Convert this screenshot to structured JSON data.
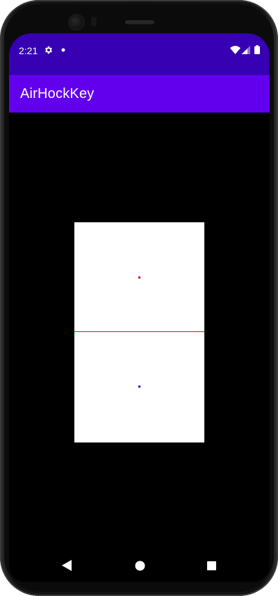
{
  "status_bar": {
    "time": "2:21",
    "icons": [
      "gear-icon",
      "notification-dot-icon",
      "wifi-icon",
      "signal-icon",
      "battery-icon"
    ],
    "background": "#3700b3"
  },
  "app_bar": {
    "title": "AirHockKey",
    "background": "#6200ee"
  },
  "game": {
    "table_color": "#ffffff",
    "center_line_color": "#e01010",
    "player1_mallet_color": "#d40000",
    "player2_mallet_color": "#1010cc"
  },
  "nav_bar": {
    "buttons": [
      "back-icon",
      "home-icon",
      "recents-icon"
    ]
  }
}
